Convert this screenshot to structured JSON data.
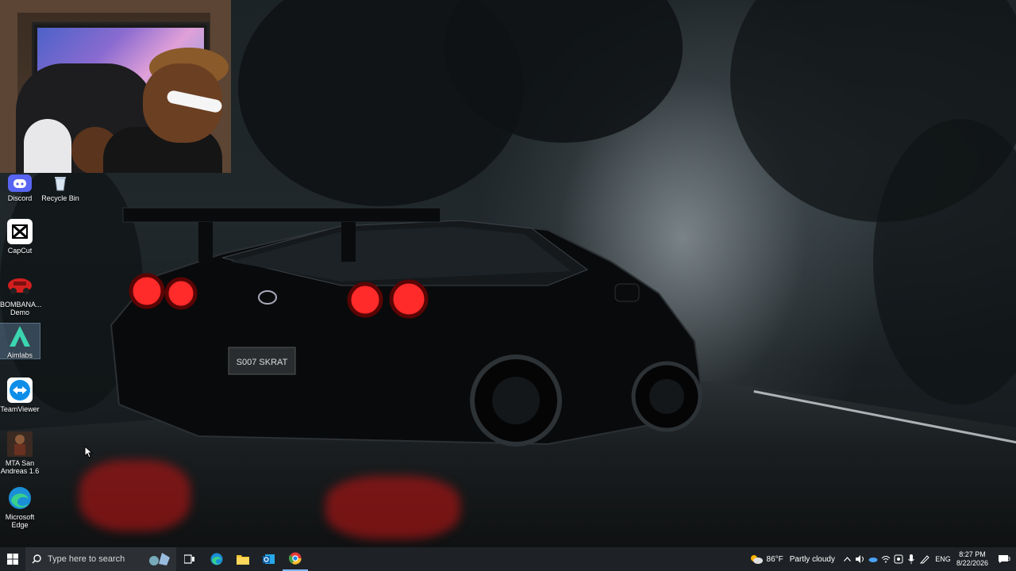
{
  "desktop": {
    "icons": [
      {
        "label": "Discord",
        "icon": "discord-icon"
      },
      {
        "label": "Recycle Bin",
        "icon": "recycle-bin-icon"
      },
      {
        "label": "CapCut",
        "icon": "capcut-icon"
      },
      {
        "label": "BOMBANA... Demo",
        "icon": "bombana-icon"
      },
      {
        "label": "Aimlabs",
        "icon": "aimlabs-icon"
      },
      {
        "label": "TeamViewer",
        "icon": "teamviewer-icon"
      },
      {
        "label": "MTA San Andreas 1.6",
        "icon": "mta-icon"
      },
      {
        "label": "Microsoft Edge",
        "icon": "edge-icon"
      }
    ],
    "plate_text": "S007 SKRAT"
  },
  "taskbar": {
    "search_placeholder": "Type here to search",
    "pinned": [
      "task-view-icon",
      "edge-icon",
      "file-explorer-icon",
      "outlook-icon",
      "chrome-icon"
    ],
    "weather_temp": "86°F",
    "weather_desc": "Partly cloudy",
    "language": "ENG",
    "time": "8:27 PM",
    "date": "8/22/2026",
    "notification_count": "3"
  },
  "colors": {
    "taskbar_bg": "#1e2226",
    "taillight": "#ff2a2a"
  }
}
